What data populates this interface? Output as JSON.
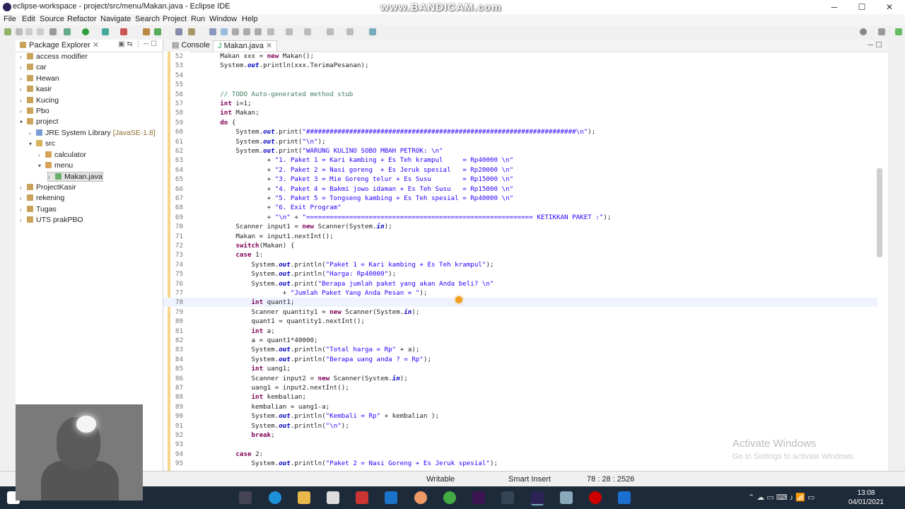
{
  "window": {
    "title": "eclipse-workspace - project/src/menu/Makan.java - Eclipse IDE",
    "watermark": "www.BANDICAM.com",
    "minimize": "─",
    "maximize": "☐",
    "close": "✕"
  },
  "menu": [
    "File",
    "Edit",
    "Source",
    "Refactor",
    "Navigate",
    "Search",
    "Project",
    "Run",
    "Window",
    "Help"
  ],
  "package_explorer": {
    "tab_label": "Package Explorer",
    "items": [
      {
        "label": "access modifier",
        "level": 0,
        "expanded": false
      },
      {
        "label": "car",
        "level": 0,
        "expanded": false
      },
      {
        "label": "Hewan",
        "level": 0,
        "expanded": false
      },
      {
        "label": "kasir",
        "level": 0,
        "expanded": false
      },
      {
        "label": "Kucing",
        "level": 0,
        "expanded": false
      },
      {
        "label": "Pbo",
        "level": 0,
        "expanded": false
      },
      {
        "label": "project",
        "level": 0,
        "expanded": true
      },
      {
        "label": "JRE System Library",
        "suffix": "[JavaSE-1.8]",
        "level": 1,
        "expanded": false
      },
      {
        "label": "src",
        "level": 1,
        "expanded": true
      },
      {
        "label": "calculator",
        "level": 2,
        "expanded": false
      },
      {
        "label": "menu",
        "level": 2,
        "expanded": true
      },
      {
        "label": "Makan.java",
        "level": 3,
        "expanded": false,
        "selected": true
      },
      {
        "label": "ProjectKasir",
        "level": 0,
        "expanded": false
      },
      {
        "label": "rekening",
        "level": 0,
        "expanded": false
      },
      {
        "label": "Tugas",
        "level": 0,
        "expanded": false
      },
      {
        "label": "UTS prakPBO",
        "level": 0,
        "expanded": false
      }
    ]
  },
  "editor": {
    "tabs": [
      {
        "label": "Console",
        "active": false
      },
      {
        "label": "Makan.java",
        "active": true
      }
    ],
    "lines": [
      {
        "n": "52",
        "text": "        Makan xxx = new Makan();"
      },
      {
        "n": "53",
        "text": "        System.out.println(xxx.TerimaPesanan);"
      },
      {
        "n": "54",
        "text": ""
      },
      {
        "n": "55",
        "text": ""
      },
      {
        "n": "56",
        "text": "        // TODO Auto-generated method stub"
      },
      {
        "n": "57",
        "text": "        int i=1;"
      },
      {
        "n": "58",
        "text": "        int Makan;"
      },
      {
        "n": "59",
        "text": "        do {"
      },
      {
        "n": "60",
        "text": "            System.out.print(\"#####################################################################\\n\");"
      },
      {
        "n": "61",
        "text": "            System.out.print(\"\\n\");"
      },
      {
        "n": "62",
        "text": "            System.out.print(\"WARUNG KULINO SOBO MBAH PETROK: \\n\""
      },
      {
        "n": "63",
        "text": "                    + \"1. Paket 1 = Kari kambing + Es Teh krampul     = Rp40000 \\n\""
      },
      {
        "n": "64",
        "text": "                    + \"2. Paket 2 = Nasi goreng  + Es Jeruk spesial   = Rp20000 \\n\""
      },
      {
        "n": "65",
        "text": "                    + \"3. Paket 3 = Mie Goreng telur + Es Susu        = Rp15000 \\n\""
      },
      {
        "n": "66",
        "text": "                    + \"4. Paket 4 = Bakmi jowo idaman + Es Teh Susu   = Rp15000 \\n\""
      },
      {
        "n": "67",
        "text": "                    + \"5. Paket 5 = Tongseng kambing + Es Teh spesial = Rp40000 \\n\""
      },
      {
        "n": "68",
        "text": "                    + \"6. Exit Program\""
      },
      {
        "n": "69",
        "text": "                    + \"\\n\" + \"========================================================== KETIKKAN PAKET :\");"
      },
      {
        "n": "70",
        "text": "            Scanner input1 = new Scanner(System.in);"
      },
      {
        "n": "71",
        "text": "            Makan = input1.nextInt();"
      },
      {
        "n": "72",
        "text": "            switch(Makan) {"
      },
      {
        "n": "73",
        "text": "            case 1:"
      },
      {
        "n": "74",
        "text": "                System.out.println(\"Paket 1 = Kari kambing + Es Teh krampul\");"
      },
      {
        "n": "75",
        "text": "                System.out.println(\"Harga: Rp40000\");"
      },
      {
        "n": "76",
        "text": "                System.out.print(\"Berapa jumlah paket yang akan Anda beli? \\n\""
      },
      {
        "n": "77",
        "text": "                        + \"Jumlah Paket Yang Anda Pesan = \");"
      },
      {
        "n": "78",
        "text": "                int quant1;"
      },
      {
        "n": "79",
        "text": "                Scanner quantity1 = new Scanner(System.in);"
      },
      {
        "n": "80",
        "text": "                quant1 = quantity1.nextInt();"
      },
      {
        "n": "81",
        "text": "                int a;"
      },
      {
        "n": "82",
        "text": "                a = quant1*40000;"
      },
      {
        "n": "83",
        "text": "                System.out.println(\"Total harga = Rp\" + a);"
      },
      {
        "n": "84",
        "text": "                System.out.println(\"Berapa uang anda ? = Rp\");"
      },
      {
        "n": "85",
        "text": "                int uang1;"
      },
      {
        "n": "86",
        "text": "                Scanner input2 = new Scanner(System.in);"
      },
      {
        "n": "87",
        "text": "                uang1 = input2.nextInt();"
      },
      {
        "n": "88",
        "text": "                int kembalian;"
      },
      {
        "n": "89",
        "text": "                kembalian = uang1-a;"
      },
      {
        "n": "90",
        "text": "                System.out.println(\"Kembali = Rp\" + kembalian );"
      },
      {
        "n": "91",
        "text": "                System.out.println(\"\\n\");"
      },
      {
        "n": "92",
        "text": "                break;"
      },
      {
        "n": "93",
        "text": ""
      },
      {
        "n": "94",
        "text": "            case 2:"
      },
      {
        "n": "95",
        "text": "                System.out.println(\"Paket 2 = Nasi Goreng + Es Jeruk spesial\");"
      }
    ],
    "current_line": "78"
  },
  "status": {
    "writable": "Writable",
    "insert_mode": "Smart Insert",
    "position": "78 : 28 : 2526"
  },
  "watermark_os": {
    "title": "Activate Windows",
    "subtitle": "Go to Settings to activate Windows."
  },
  "clock": {
    "time": "13:08",
    "date": "04/01/2021"
  },
  "colors": {
    "keyword": "#7f0055",
    "string": "#2a00ff",
    "comment": "#3f7f5f",
    "field": "#0000c0"
  }
}
